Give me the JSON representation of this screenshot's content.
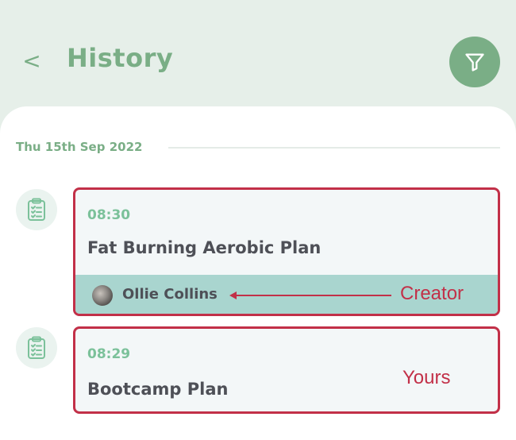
{
  "header": {
    "back_label": "<",
    "title": "History",
    "filter_icon": "filter-icon"
  },
  "history": {
    "date": "Thu 15th Sep 2022",
    "entries": [
      {
        "time": "08:30",
        "plan": "Fat Burning Aerobic Plan",
        "creator": "Ollie Collins",
        "annotation": "Creator",
        "icon": "clipboard-checklist-icon"
      },
      {
        "time": "08:29",
        "plan": "Bootcamp Plan",
        "annotation": "Yours",
        "icon": "clipboard-checklist-icon"
      }
    ]
  },
  "colors": {
    "accent_green": "#7aae86",
    "time_green": "#7bc19a",
    "creator_bar": "#a9d5cf",
    "annotation_red": "#c23048"
  }
}
